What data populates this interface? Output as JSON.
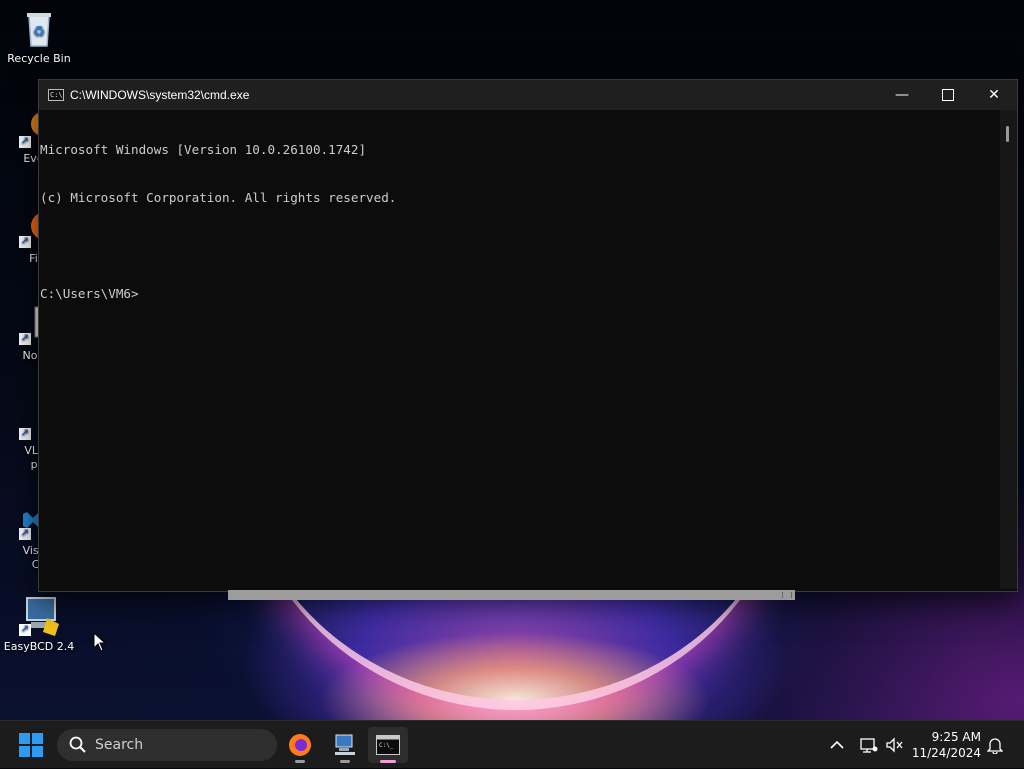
{
  "desktop": {
    "icons": [
      {
        "label": "Recycle Bin"
      },
      {
        "label": "Every"
      },
      {
        "label": "Fire"
      },
      {
        "label": "Notep"
      },
      {
        "label": "VLC r",
        "label2": "pla"
      },
      {
        "label": "Visual",
        "label2": "Co"
      },
      {
        "label": "EasyBCD 2.4"
      }
    ]
  },
  "window": {
    "title": "C:\\WINDOWS\\system32\\cmd.exe",
    "minimize_glyph": "—",
    "maximize_glyph": "☐",
    "close_glyph": "✕",
    "console_lines": [
      "Microsoft Windows [Version 10.0.26100.1742]",
      "(c) Microsoft Corporation. All rights reserved.",
      "",
      "C:\\Users\\VM6>"
    ]
  },
  "taskbar": {
    "search_label": "Search",
    "time": "9:25 AM",
    "date": "11/24/2024",
    "apps": [
      "firefox-icon",
      "network-computer-icon",
      "command-prompt-icon"
    ]
  },
  "colors": {
    "console_bg": "#0c0c0c",
    "console_text": "#cccccc",
    "titlebar_bg": "#1f1f1f",
    "taskbar_bg": "#1c1c1c",
    "start_blue": "#2e9bf0"
  }
}
